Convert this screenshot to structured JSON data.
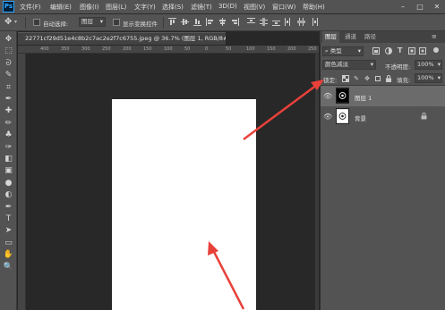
{
  "app": {
    "logo": "Ps"
  },
  "menu": [
    "文件(F)",
    "编辑(E)",
    "图像(I)",
    "图层(L)",
    "文字(Y)",
    "选择(S)",
    "滤镜(T)",
    "3D(D)",
    "视图(V)",
    "窗口(W)",
    "帮助(H)"
  ],
  "window_controls": {
    "minimize": "–",
    "maximize": "□",
    "close": "✕"
  },
  "options_bar": {
    "auto_select_label": "自动选择:",
    "auto_select_value": "图层",
    "show_transform_label": "显示变换控件"
  },
  "document": {
    "tab_title": "22771cf29d51e4c8b2c7ac2e2f7c6755.jpeg @ 36.7% (图层 1, RGB/8#) *",
    "close": "×"
  },
  "ruler_ticks": [
    "400",
    "350",
    "300",
    "250",
    "200",
    "150",
    "100",
    "50",
    "0",
    "50",
    "100",
    "150",
    "200",
    "250"
  ],
  "tools": [
    "move-tool",
    "marquee-tool",
    "lasso-tool",
    "quick-select-tool",
    "crop-tool",
    "eyedropper-tool",
    "healing-tool",
    "brush-tool",
    "clone-stamp-tool",
    "history-brush-tool",
    "eraser-tool",
    "gradient-tool",
    "blur-tool",
    "dodge-tool",
    "pen-tool",
    "type-tool",
    "path-select-tool",
    "shape-tool",
    "hand-tool",
    "zoom-tool"
  ],
  "tool_glyphs": [
    "✥",
    "⬚",
    "ᘐ",
    "✎",
    "⌗",
    "✒",
    "✚",
    "✏",
    "♣",
    "✑",
    "◧",
    "▣",
    "●",
    "◐",
    "✒",
    "T",
    "➤",
    "▭",
    "✋",
    "🔍"
  ],
  "layers_panel": {
    "tabs": [
      "图层",
      "通道",
      "路径"
    ],
    "filter_kind": "类型",
    "blend_mode": "颜色减淡",
    "opacity_label": "不透明度:",
    "opacity_value": "100%",
    "lock_label": "锁定:",
    "fill_label": "填充:",
    "fill_value": "100%",
    "layers": [
      {
        "name": "图层 1",
        "selected": true
      },
      {
        "name": "背景",
        "selected": false,
        "locked": true
      }
    ]
  },
  "colors": {
    "accent_arrow": "#e8413a",
    "panel": "#535353",
    "workspace": "#282828"
  }
}
